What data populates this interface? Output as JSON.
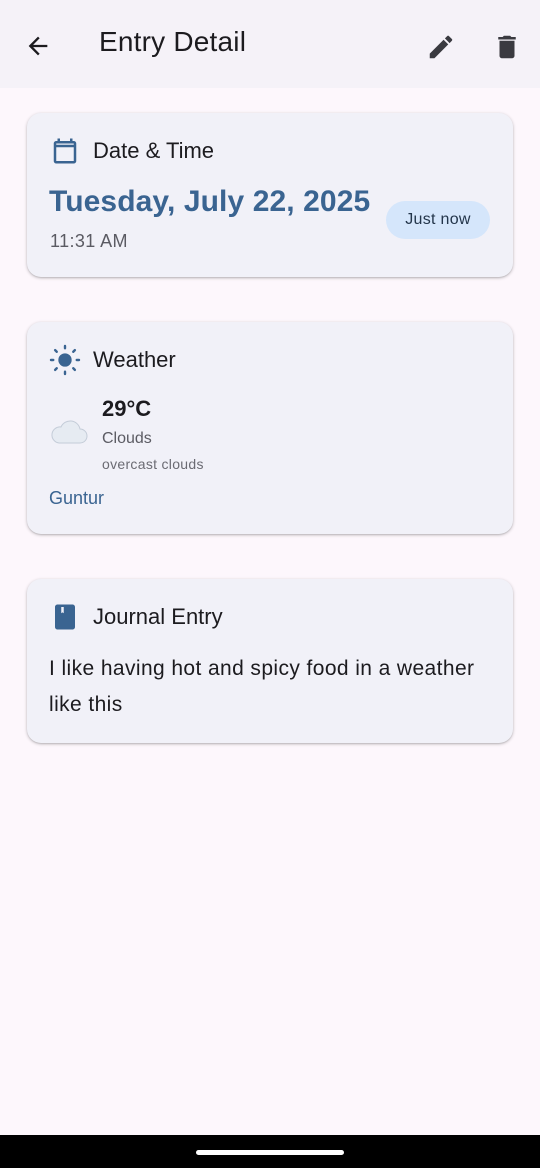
{
  "appbar": {
    "title": "Entry Detail",
    "icons": {
      "back": "arrow-back-icon",
      "edit": "pencil-icon",
      "delete": "trash-icon"
    }
  },
  "date_card": {
    "header": "Date & Time",
    "icon": "calendar-icon",
    "date": "Tuesday, July 22, 2025",
    "time": "11:31 AM",
    "badge": "Just now"
  },
  "weather_card": {
    "header": "Weather",
    "icon": "sun-icon",
    "condition_icon": "cloud-icon",
    "temperature": "29°C",
    "condition": "Clouds",
    "description": "overcast clouds",
    "location": "Guntur"
  },
  "journal_card": {
    "header": "Journal Entry",
    "icon": "book-icon",
    "text": "I like having hot and spicy food in a weather like this"
  },
  "colors": {
    "accent": "#3a6491",
    "card_bg": "#f1f1f8",
    "page_bg": "#fdf7fc",
    "badge_bg": "#d5e6fb"
  }
}
